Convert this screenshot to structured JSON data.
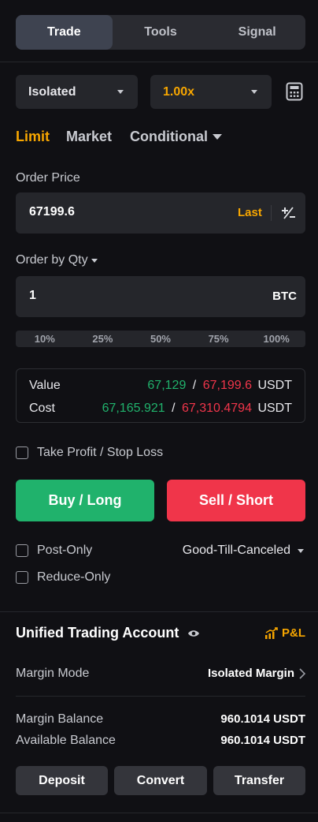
{
  "tabs": [
    "Trade",
    "Tools",
    "Signal"
  ],
  "margin_type": "Isolated",
  "leverage": "1.00x",
  "order_types": {
    "limit": "Limit",
    "market": "Market",
    "conditional": "Conditional"
  },
  "order_price": {
    "label": "Order Price",
    "value": "67199.6",
    "last": "Last"
  },
  "qty": {
    "label": "Order by Qty",
    "value": "1",
    "unit": "BTC"
  },
  "percents": [
    "10%",
    "25%",
    "50%",
    "75%",
    "100%"
  ],
  "summary": {
    "value_label": "Value",
    "value_buy": "67,129",
    "value_sell": "67,199.6",
    "cost_label": "Cost",
    "cost_buy": "67,165.921",
    "cost_sell": "67,310.4794",
    "sep": "/",
    "currency": "USDT"
  },
  "tpsl_label": "Take Profit / Stop Loss",
  "buy_label": "Buy / Long",
  "sell_label": "Sell / Short",
  "post_only": "Post-Only",
  "reduce_only": "Reduce-Only",
  "tif": "Good-Till-Canceled",
  "account": {
    "title": "Unified Trading Account",
    "pnl": "P&L",
    "margin_mode_label": "Margin Mode",
    "margin_mode_value": "Isolated Margin",
    "margin_balance_label": "Margin Balance",
    "margin_balance_value": "960.1014 USDT",
    "available_balance_label": "Available Balance",
    "available_balance_value": "960.1014 USDT"
  },
  "actions": {
    "deposit": "Deposit",
    "convert": "Convert",
    "transfer": "Transfer"
  },
  "colors": {
    "accent": "#f7a600",
    "buy": "#20b26c",
    "sell": "#f0354a"
  }
}
